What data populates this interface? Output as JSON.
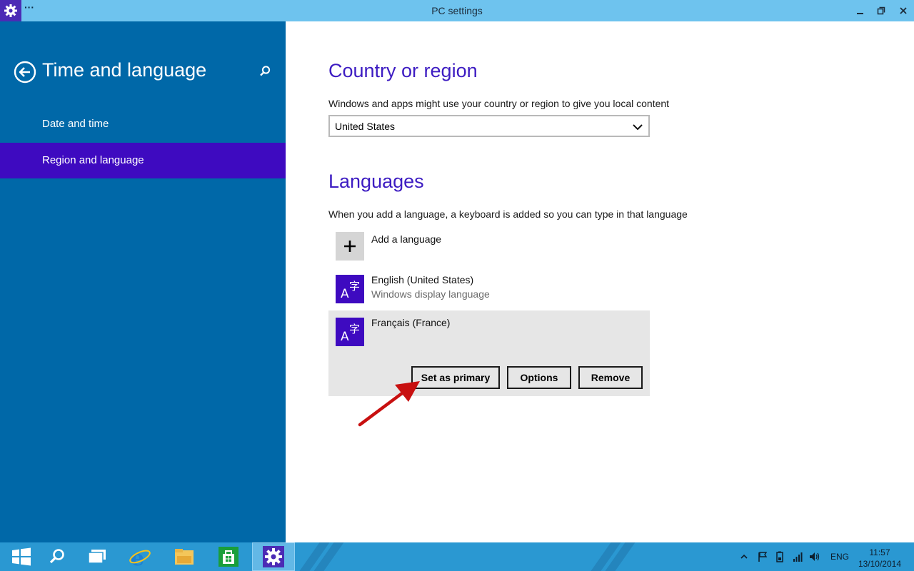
{
  "window": {
    "title": "PC settings",
    "menu_label": "···"
  },
  "sidebar": {
    "title": "Time and language",
    "items": [
      {
        "label": "Date and time"
      },
      {
        "label": "Region and language"
      }
    ]
  },
  "country": {
    "heading": "Country or region",
    "description": "Windows and apps might use your country or region to give you local content",
    "selected": "United States"
  },
  "languages": {
    "heading": "Languages",
    "description": "When you add a language, a keyboard is added so you can type in that language",
    "add_label": "Add a language",
    "items": [
      {
        "name": "English (United States)",
        "subtitle": "Windows display language",
        "icon": "language-icon"
      },
      {
        "name": "Français (France)",
        "subtitle": "",
        "icon": "language-icon"
      }
    ],
    "actions": {
      "set_primary": "Set as primary",
      "options": "Options",
      "remove": "Remove"
    }
  },
  "taskbar": {
    "language": "ENG",
    "time": "11:57",
    "date": "13/10/2014"
  },
  "colors": {
    "sidebar": "#0068a8",
    "accent": "#3e0ac0",
    "heading": "#3d1cc2",
    "titlebar": "#6ec3ee",
    "taskbar": "#2a98d2",
    "annotation_arrow": "#c81010"
  }
}
